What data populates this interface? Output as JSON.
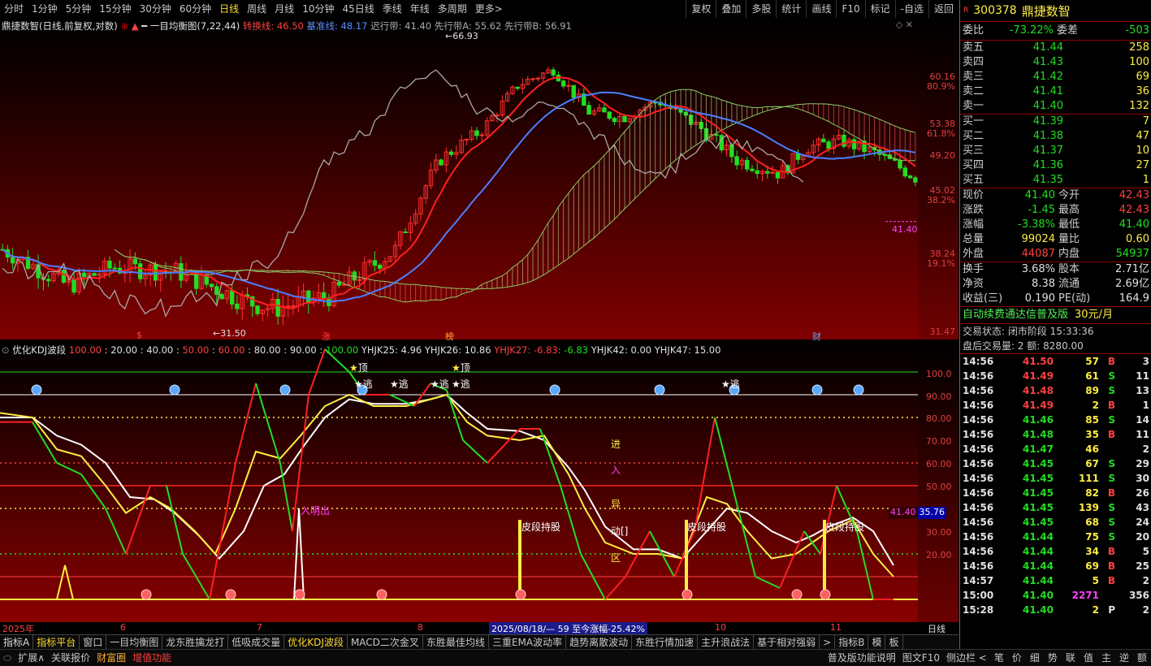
{
  "toolbar": {
    "periods": [
      "分时",
      "1分钟",
      "5分钟",
      "15分钟",
      "30分钟",
      "60分钟",
      "日线",
      "周线",
      "月线",
      "10分钟",
      "45日线",
      "季线",
      "年线",
      "多周期",
      "更多>"
    ],
    "active_period": "日线",
    "right_tools": [
      "复权",
      "叠加",
      "多股",
      "统计",
      "画线",
      "F10",
      "标记",
      "-自选",
      "返回"
    ]
  },
  "main_chart": {
    "header": {
      "stock_title": "鼎捷数智(日线,前复权,对数)",
      "indicator": "一目均衡图(7,22,44)",
      "conv_label": "转换线: 46.50",
      "base_label": "基准线: 48.17",
      "lag_label": "迟行带: 41.40",
      "spanA_label": "先行带A: 55.62",
      "spanB_label": "先行带B: 56.91"
    },
    "annotations": {
      "high": "66.93",
      "low": "31.50",
      "last": "41.40"
    },
    "markers": [
      "$",
      "涨",
      "榜",
      "财"
    ],
    "axis_ticks": [
      "60.16",
      "80.9%",
      "53.38",
      "61.8%",
      "49.20",
      "45.02",
      "38.2%",
      "38.24",
      "19.1%",
      "31.47"
    ],
    "colors": {
      "conversion": "#ff2020",
      "base": "#4a7fff",
      "lagging": "#a8a8a8",
      "kumo": "#88cc66"
    }
  },
  "sub_chart": {
    "header": {
      "name": "优化KDJ波段",
      "v1": "100.00",
      "v2": "20.00",
      "v3": "40.00",
      "v4": "50.00",
      "v5": "60.00",
      "v6": "80.00",
      "v7": "90.00",
      "v8": "100.00",
      "yh25": "YHJK25: 4.96",
      "yh26": "YHJK26: 10.86",
      "yh27": "YHJK27: -6.83",
      "yh27b": ": -6.83",
      "yh42": "YHJK42: 0.00",
      "yh47": "YHJK47: 15.00"
    },
    "axis_ticks": [
      "100.0",
      "90.00",
      "80.00",
      "70.00",
      "60.00",
      "50.00",
      "40.00",
      "30.00",
      "20.00"
    ],
    "price_tag": "41.40",
    "value_tag": "35.76",
    "labels": {
      "top1": "顶",
      "top2": "顶",
      "escape": "逃",
      "enter_label": "进",
      "enter2": "入",
      "yi": "异",
      "dong": "动[]",
      "qu": "区",
      "hold": "皮段持股",
      "buy_hint": "入明出"
    },
    "chart_data": {
      "type": "line",
      "title": "优化KDJ波段",
      "ylim": [
        0,
        105
      ],
      "series": [
        {
          "name": "K",
          "color": "#ff2020"
        },
        {
          "name": "D",
          "color": "#ffee44"
        },
        {
          "name": "J",
          "color": "#ffffff"
        }
      ]
    }
  },
  "date_axis": {
    "labels": [
      "2025年",
      "6",
      "7",
      "8",
      "9",
      "10",
      "11"
    ],
    "range_text": "2025/08/18/— 59 至今涨幅-25.42%",
    "period": "日线"
  },
  "indicator_tabs": [
    "指标A",
    "指标平台",
    "窗口",
    "一目均衡图",
    "龙东胜擒龙打",
    "低吸成交量",
    "优化KDJ波段",
    "MACD二次金叉",
    "东胜最佳均线",
    "三重EMA波动率",
    "趋势离散波动",
    "东胜行情加速",
    "主升浪战法",
    "基于相对强弱",
    ">",
    "指标B",
    "模",
    "板"
  ],
  "bottom_bar": {
    "left": [
      "扩展∧",
      "关联报价",
      "财富圈",
      "增值功能"
    ],
    "right": [
      "普及版功能说明",
      "图文F10",
      "侧边栏 <"
    ],
    "chars": [
      "笔",
      "价",
      "细",
      "势",
      "联",
      "值",
      "主",
      "逆",
      "额"
    ]
  },
  "quote": {
    "code": "300378",
    "name": "鼎捷数智",
    "weibi_label": "委比",
    "weibi": "-73.22%",
    "weicha_label": "委差",
    "weicha": "-503",
    "sells": [
      {
        "label": "卖五",
        "price": "41.44",
        "vol": "258"
      },
      {
        "label": "卖四",
        "price": "41.43",
        "vol": "100"
      },
      {
        "label": "卖三",
        "price": "41.42",
        "vol": "69"
      },
      {
        "label": "卖二",
        "price": "41.41",
        "vol": "36"
      },
      {
        "label": "卖一",
        "price": "41.40",
        "vol": "132"
      }
    ],
    "buys": [
      {
        "label": "买一",
        "price": "41.39",
        "vol": "7"
      },
      {
        "label": "买二",
        "price": "41.38",
        "vol": "47"
      },
      {
        "label": "买三",
        "price": "41.37",
        "vol": "10"
      },
      {
        "label": "买四",
        "price": "41.36",
        "vol": "27"
      },
      {
        "label": "买五",
        "price": "41.35",
        "vol": "1"
      }
    ],
    "stats": [
      {
        "l1": "现价",
        "v1": "41.40",
        "c1": "green",
        "l2": "今开",
        "v2": "42.43",
        "c2": "red"
      },
      {
        "l1": "涨跌",
        "v1": "-1.45",
        "c1": "green",
        "l2": "最高",
        "v2": "42.43",
        "c2": "red"
      },
      {
        "l1": "涨幅",
        "v1": "-3.38%",
        "c1": "green",
        "l2": "最低",
        "v2": "41.40",
        "c2": "green"
      },
      {
        "l1": "总量",
        "v1": "99024",
        "c1": "yellow",
        "l2": "量比",
        "v2": "0.60",
        "c2": "yellow"
      },
      {
        "l1": "外盘",
        "v1": "44087",
        "c1": "red",
        "l2": "内盘",
        "v2": "54937",
        "c2": "green"
      }
    ],
    "fund": [
      {
        "l1": "换手",
        "v1": "3.68%",
        "l2": "股本",
        "v2": "2.71亿"
      },
      {
        "l1": "净资",
        "v1": "8.38",
        "l2": "流通",
        "v2": "2.69亿"
      },
      {
        "l1": "收益(三)",
        "v1": "0.190",
        "l2": "PE(动)",
        "v2": "164.9"
      }
    ],
    "ad_text": "自动续费通达信普及版",
    "ad_price": "30元/月",
    "status_line": "交易状态: 闭市阶段 15:33:36",
    "after_hours": "盘后交易量: 2  额: 8280.00",
    "ticks": [
      {
        "t": "14:56",
        "p": "41.50",
        "pc": "red",
        "v": "57",
        "bs": "B",
        "n": "3"
      },
      {
        "t": "14:56",
        "p": "41.49",
        "pc": "red",
        "v": "61",
        "bs": "S",
        "n": "11"
      },
      {
        "t": "14:56",
        "p": "41.48",
        "pc": "red",
        "v": "89",
        "bs": "S",
        "n": "13"
      },
      {
        "t": "14:56",
        "p": "41.49",
        "pc": "red",
        "v": "2",
        "bs": "B",
        "n": "1"
      },
      {
        "t": "14:56",
        "p": "41.46",
        "pc": "green",
        "v": "85",
        "bs": "S",
        "n": "14"
      },
      {
        "t": "14:56",
        "p": "41.48",
        "pc": "green",
        "v": "35",
        "bs": "B",
        "n": "11"
      },
      {
        "t": "14:56",
        "p": "41.47",
        "pc": "green",
        "v": "46",
        "bs": "",
        "n": "2"
      },
      {
        "t": "14:56",
        "p": "41.45",
        "pc": "green",
        "v": "67",
        "bs": "S",
        "n": "29"
      },
      {
        "t": "14:56",
        "p": "41.45",
        "pc": "green",
        "v": "111",
        "bs": "S",
        "n": "30"
      },
      {
        "t": "14:56",
        "p": "41.45",
        "pc": "green",
        "v": "82",
        "bs": "B",
        "n": "26"
      },
      {
        "t": "14:56",
        "p": "41.45",
        "pc": "green",
        "v": "139",
        "bs": "S",
        "n": "43"
      },
      {
        "t": "14:56",
        "p": "41.45",
        "pc": "green",
        "v": "68",
        "bs": "S",
        "n": "24"
      },
      {
        "t": "14:56",
        "p": "41.44",
        "pc": "green",
        "v": "75",
        "bs": "S",
        "n": "20"
      },
      {
        "t": "14:56",
        "p": "41.44",
        "pc": "green",
        "v": "34",
        "bs": "B",
        "n": "5"
      },
      {
        "t": "14:56",
        "p": "41.44",
        "pc": "green",
        "v": "69",
        "bs": "B",
        "n": "25"
      },
      {
        "t": "14:57",
        "p": "41.44",
        "pc": "green",
        "v": "5",
        "bs": "B",
        "n": "2"
      },
      {
        "t": "15:00",
        "p": "41.40",
        "pc": "green",
        "v": "2271",
        "bs": "",
        "n": "356"
      },
      {
        "t": "15:28",
        "p": "41.40",
        "pc": "green",
        "v": "2",
        "bs": "P",
        "n": "2"
      }
    ]
  }
}
